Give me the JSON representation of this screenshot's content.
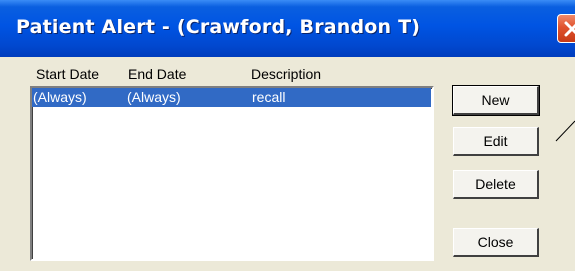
{
  "window": {
    "title": "Patient Alert - (Crawford, Brandon T)"
  },
  "list": {
    "columns": [
      "Start Date",
      "End Date",
      "Description"
    ],
    "rows": [
      {
        "start": "(Always)",
        "end": "(Always)",
        "description": "recall",
        "selected": true
      }
    ]
  },
  "buttons": {
    "new_label": "New",
    "edit_label": "Edit",
    "delete_label": "Delete",
    "close_label": "Close"
  },
  "colors": {
    "titlebar": "#0054e3",
    "selection": "#316ac5",
    "dialog_bg": "#ece9d8",
    "close_button": "#e0532e"
  }
}
